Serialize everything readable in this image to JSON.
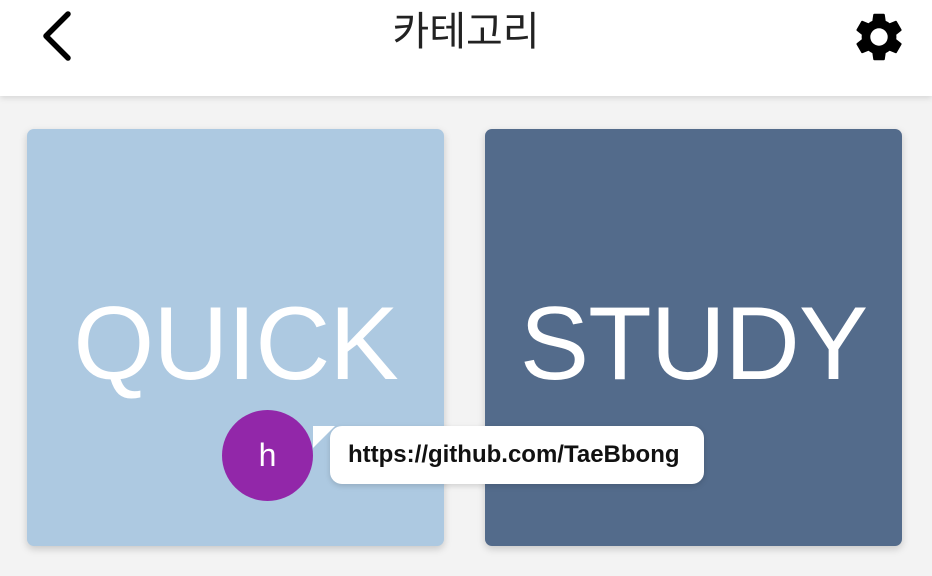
{
  "header": {
    "title": "카테고리",
    "back_icon": "chevron-left-icon",
    "settings_icon": "gear-icon"
  },
  "cards": [
    {
      "label": "QUICK",
      "color": "#adc9e1"
    },
    {
      "label": "STUDY",
      "color": "#536b8b"
    }
  ],
  "overlay": {
    "avatar_letter": "h",
    "avatar_color": "#9227a9",
    "bubble_text": "https://github.com/TaeBbong"
  },
  "colors": {
    "background": "#f3f3f3",
    "appbar": "#ffffff",
    "icon": "#000000"
  }
}
